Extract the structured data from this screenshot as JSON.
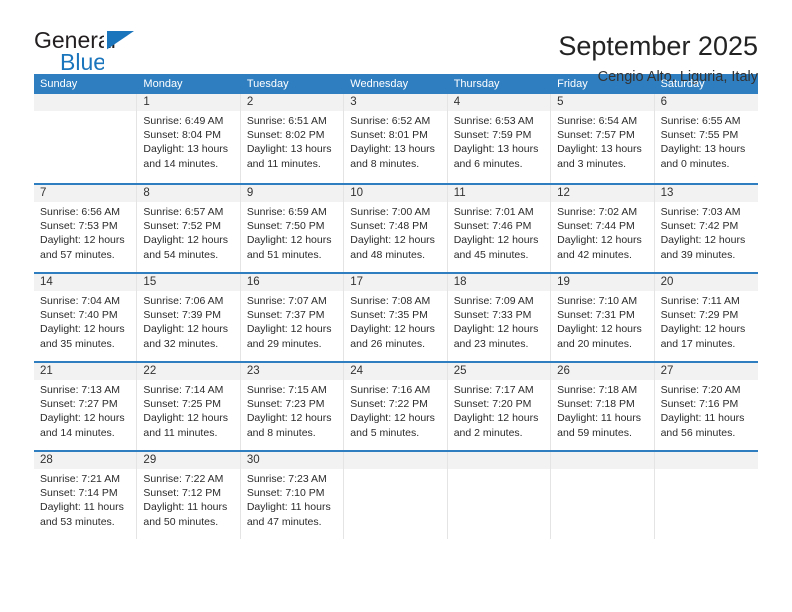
{
  "brand": {
    "name_part1": "General",
    "name_part2": "Blue",
    "accent_color": "#1b75bc"
  },
  "header": {
    "title": "September 2025",
    "subtitle": "Cengio Alto, Liguria, Italy"
  },
  "calendar": {
    "header_bg": "#2f7ec0",
    "weekdays": [
      "Sunday",
      "Monday",
      "Tuesday",
      "Wednesday",
      "Thursday",
      "Friday",
      "Saturday"
    ],
    "weeks": [
      [
        {
          "day": "",
          "sunrise": "",
          "sunset": "",
          "daylight1": "",
          "daylight2": ""
        },
        {
          "day": "1",
          "sunrise": "Sunrise: 6:49 AM",
          "sunset": "Sunset: 8:04 PM",
          "daylight1": "Daylight: 13 hours",
          "daylight2": "and 14 minutes."
        },
        {
          "day": "2",
          "sunrise": "Sunrise: 6:51 AM",
          "sunset": "Sunset: 8:02 PM",
          "daylight1": "Daylight: 13 hours",
          "daylight2": "and 11 minutes."
        },
        {
          "day": "3",
          "sunrise": "Sunrise: 6:52 AM",
          "sunset": "Sunset: 8:01 PM",
          "daylight1": "Daylight: 13 hours",
          "daylight2": "and 8 minutes."
        },
        {
          "day": "4",
          "sunrise": "Sunrise: 6:53 AM",
          "sunset": "Sunset: 7:59 PM",
          "daylight1": "Daylight: 13 hours",
          "daylight2": "and 6 minutes."
        },
        {
          "day": "5",
          "sunrise": "Sunrise: 6:54 AM",
          "sunset": "Sunset: 7:57 PM",
          "daylight1": "Daylight: 13 hours",
          "daylight2": "and 3 minutes."
        },
        {
          "day": "6",
          "sunrise": "Sunrise: 6:55 AM",
          "sunset": "Sunset: 7:55 PM",
          "daylight1": "Daylight: 13 hours",
          "daylight2": "and 0 minutes."
        }
      ],
      [
        {
          "day": "7",
          "sunrise": "Sunrise: 6:56 AM",
          "sunset": "Sunset: 7:53 PM",
          "daylight1": "Daylight: 12 hours",
          "daylight2": "and 57 minutes."
        },
        {
          "day": "8",
          "sunrise": "Sunrise: 6:57 AM",
          "sunset": "Sunset: 7:52 PM",
          "daylight1": "Daylight: 12 hours",
          "daylight2": "and 54 minutes."
        },
        {
          "day": "9",
          "sunrise": "Sunrise: 6:59 AM",
          "sunset": "Sunset: 7:50 PM",
          "daylight1": "Daylight: 12 hours",
          "daylight2": "and 51 minutes."
        },
        {
          "day": "10",
          "sunrise": "Sunrise: 7:00 AM",
          "sunset": "Sunset: 7:48 PM",
          "daylight1": "Daylight: 12 hours",
          "daylight2": "and 48 minutes."
        },
        {
          "day": "11",
          "sunrise": "Sunrise: 7:01 AM",
          "sunset": "Sunset: 7:46 PM",
          "daylight1": "Daylight: 12 hours",
          "daylight2": "and 45 minutes."
        },
        {
          "day": "12",
          "sunrise": "Sunrise: 7:02 AM",
          "sunset": "Sunset: 7:44 PM",
          "daylight1": "Daylight: 12 hours",
          "daylight2": "and 42 minutes."
        },
        {
          "day": "13",
          "sunrise": "Sunrise: 7:03 AM",
          "sunset": "Sunset: 7:42 PM",
          "daylight1": "Daylight: 12 hours",
          "daylight2": "and 39 minutes."
        }
      ],
      [
        {
          "day": "14",
          "sunrise": "Sunrise: 7:04 AM",
          "sunset": "Sunset: 7:40 PM",
          "daylight1": "Daylight: 12 hours",
          "daylight2": "and 35 minutes."
        },
        {
          "day": "15",
          "sunrise": "Sunrise: 7:06 AM",
          "sunset": "Sunset: 7:39 PM",
          "daylight1": "Daylight: 12 hours",
          "daylight2": "and 32 minutes."
        },
        {
          "day": "16",
          "sunrise": "Sunrise: 7:07 AM",
          "sunset": "Sunset: 7:37 PM",
          "daylight1": "Daylight: 12 hours",
          "daylight2": "and 29 minutes."
        },
        {
          "day": "17",
          "sunrise": "Sunrise: 7:08 AM",
          "sunset": "Sunset: 7:35 PM",
          "daylight1": "Daylight: 12 hours",
          "daylight2": "and 26 minutes."
        },
        {
          "day": "18",
          "sunrise": "Sunrise: 7:09 AM",
          "sunset": "Sunset: 7:33 PM",
          "daylight1": "Daylight: 12 hours",
          "daylight2": "and 23 minutes."
        },
        {
          "day": "19",
          "sunrise": "Sunrise: 7:10 AM",
          "sunset": "Sunset: 7:31 PM",
          "daylight1": "Daylight: 12 hours",
          "daylight2": "and 20 minutes."
        },
        {
          "day": "20",
          "sunrise": "Sunrise: 7:11 AM",
          "sunset": "Sunset: 7:29 PM",
          "daylight1": "Daylight: 12 hours",
          "daylight2": "and 17 minutes."
        }
      ],
      [
        {
          "day": "21",
          "sunrise": "Sunrise: 7:13 AM",
          "sunset": "Sunset: 7:27 PM",
          "daylight1": "Daylight: 12 hours",
          "daylight2": "and 14 minutes."
        },
        {
          "day": "22",
          "sunrise": "Sunrise: 7:14 AM",
          "sunset": "Sunset: 7:25 PM",
          "daylight1": "Daylight: 12 hours",
          "daylight2": "and 11 minutes."
        },
        {
          "day": "23",
          "sunrise": "Sunrise: 7:15 AM",
          "sunset": "Sunset: 7:23 PM",
          "daylight1": "Daylight: 12 hours",
          "daylight2": "and 8 minutes."
        },
        {
          "day": "24",
          "sunrise": "Sunrise: 7:16 AM",
          "sunset": "Sunset: 7:22 PM",
          "daylight1": "Daylight: 12 hours",
          "daylight2": "and 5 minutes."
        },
        {
          "day": "25",
          "sunrise": "Sunrise: 7:17 AM",
          "sunset": "Sunset: 7:20 PM",
          "daylight1": "Daylight: 12 hours",
          "daylight2": "and 2 minutes."
        },
        {
          "day": "26",
          "sunrise": "Sunrise: 7:18 AM",
          "sunset": "Sunset: 7:18 PM",
          "daylight1": "Daylight: 11 hours",
          "daylight2": "and 59 minutes."
        },
        {
          "day": "27",
          "sunrise": "Sunrise: 7:20 AM",
          "sunset": "Sunset: 7:16 PM",
          "daylight1": "Daylight: 11 hours",
          "daylight2": "and 56 minutes."
        }
      ],
      [
        {
          "day": "28",
          "sunrise": "Sunrise: 7:21 AM",
          "sunset": "Sunset: 7:14 PM",
          "daylight1": "Daylight: 11 hours",
          "daylight2": "and 53 minutes."
        },
        {
          "day": "29",
          "sunrise": "Sunrise: 7:22 AM",
          "sunset": "Sunset: 7:12 PM",
          "daylight1": "Daylight: 11 hours",
          "daylight2": "and 50 minutes."
        },
        {
          "day": "30",
          "sunrise": "Sunrise: 7:23 AM",
          "sunset": "Sunset: 7:10 PM",
          "daylight1": "Daylight: 11 hours",
          "daylight2": "and 47 minutes."
        },
        {
          "day": "",
          "sunrise": "",
          "sunset": "",
          "daylight1": "",
          "daylight2": ""
        },
        {
          "day": "",
          "sunrise": "",
          "sunset": "",
          "daylight1": "",
          "daylight2": ""
        },
        {
          "day": "",
          "sunrise": "",
          "sunset": "",
          "daylight1": "",
          "daylight2": ""
        },
        {
          "day": "",
          "sunrise": "",
          "sunset": "",
          "daylight1": "",
          "daylight2": ""
        }
      ]
    ]
  }
}
